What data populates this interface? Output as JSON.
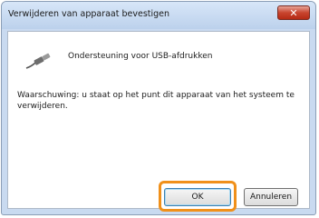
{
  "dialog": {
    "title": "Verwijderen van apparaat bevestigen",
    "close_icon": "close-icon",
    "device_icon": "usb-cable-icon",
    "device_name": "Ondersteuning voor USB-afdrukken",
    "warning": "Waarschuwing: u staat op het punt dit apparaat van het systeem te verwijderen.",
    "ok_label": "OK",
    "cancel_label": "Annuleren",
    "highlight_color": "#f0901a"
  }
}
